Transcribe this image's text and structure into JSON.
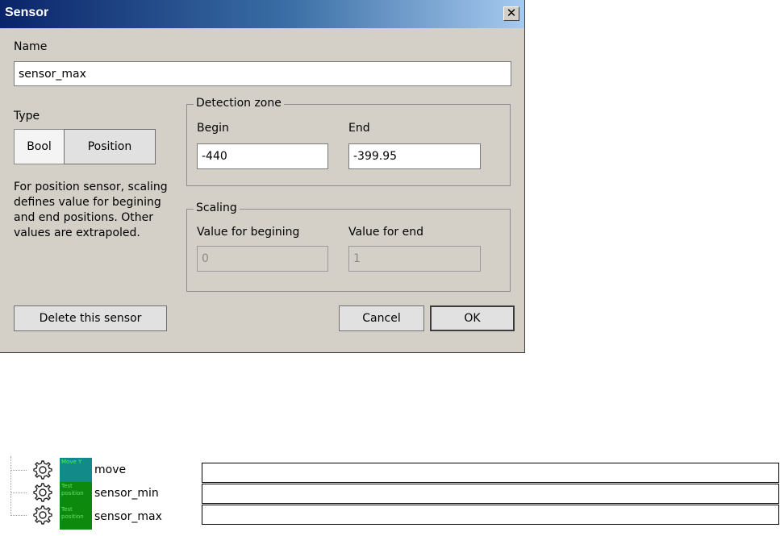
{
  "dialog": {
    "title": "Sensor",
    "close_symbol": "✕",
    "name_label": "Name",
    "name_value": "sensor_max",
    "type_label": "Type",
    "type_options": [
      "Bool",
      "Position"
    ],
    "type_selected": "Bool",
    "help_lines": [
      "For position sensor, scaling",
      "defines value for begining",
      "and end positions. Other",
      "values are extrapoled."
    ],
    "detection_zone": {
      "title": "Detection zone",
      "begin_label": "Begin",
      "begin_value": "-440",
      "end_label": "End",
      "end_value": "-399.95"
    },
    "scaling": {
      "title": "Scaling",
      "begin_label": "Value for begining",
      "begin_value": "0",
      "end_label": "Value for end",
      "end_value": "1"
    },
    "delete_label": "Delete this sensor",
    "cancel_label": "Cancel",
    "ok_label": "OK"
  },
  "tree": {
    "nodes": [
      {
        "badge": "Move Y",
        "badge_color": "#138a8a",
        "label": "move",
        "icon": "gear-icon"
      },
      {
        "badge": "Test position",
        "badge_color": "#0d8a0d",
        "label": "sensor_min",
        "icon": "gear-icon"
      },
      {
        "badge": "Test position",
        "badge_color": "#0d8a0d",
        "label": "sensor_max",
        "icon": "gear-icon"
      }
    ]
  }
}
